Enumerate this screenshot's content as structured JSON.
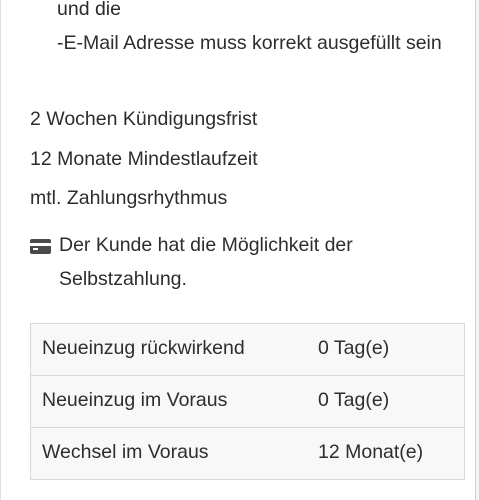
{
  "requirements": {
    "cut_top": "Die Telefonnummer muss korrekt ausgefüllt sein und die",
    "email_line": "-E-Mail Adresse muss korrekt ausgefüllt sein"
  },
  "contract": {
    "notice_period": "2 Wochen Kündigungsfrist",
    "min_term": "12 Monate Mindestlaufzeit",
    "payment_rhythm": "mtl. Zahlungsrhythmus"
  },
  "self_payment": {
    "icon": "credit-card-icon",
    "text": "Der Kunde hat die Möglichkeit der Selbstzahlung."
  },
  "table": {
    "rows": [
      {
        "label": "Neueinzug rückwirkend",
        "value": "0 Tag(e)"
      },
      {
        "label": "Neueinzug im Voraus",
        "value": "0 Tag(e)"
      },
      {
        "label": "Wechsel im Voraus",
        "value": "12 Monat(e)"
      }
    ]
  }
}
